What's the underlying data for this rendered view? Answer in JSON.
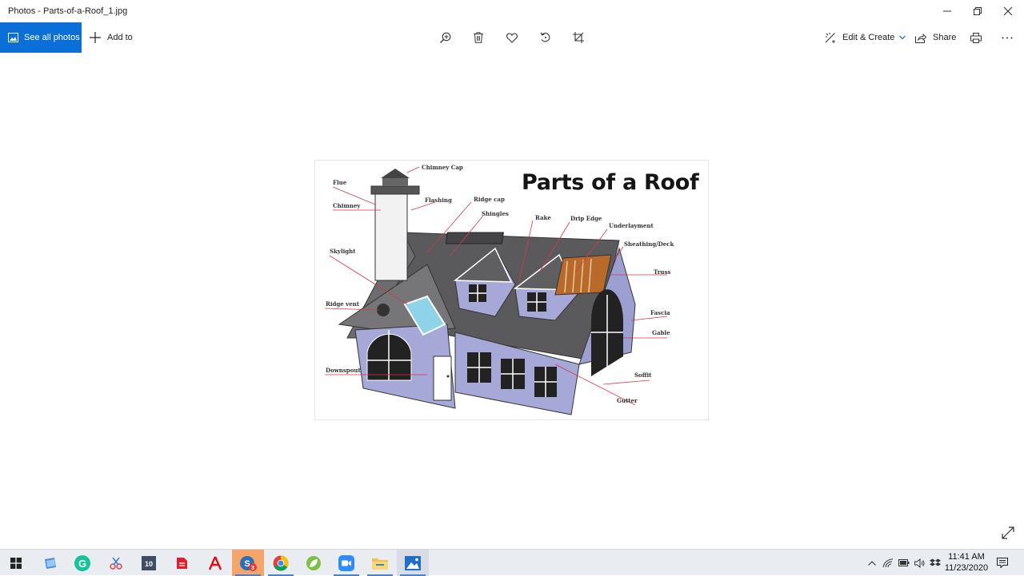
{
  "window": {
    "title": "Photos - Parts-of-a-Roof_1.jpg",
    "minimize_icon": "minimize-icon",
    "restore_icon": "restore-icon",
    "close_icon": "close-icon"
  },
  "toolbar": {
    "see_all_label": "See all photos",
    "add_to_label": "Add to",
    "zoom_icon": "zoom-in-icon",
    "delete_icon": "trash-icon",
    "favorite_icon": "heart-icon",
    "rotate_icon": "rotate-icon",
    "crop_icon": "crop-icon",
    "edit_create_label": "Edit & Create",
    "share_label": "Share",
    "print_icon": "printer-icon",
    "more_icon": "more-icon"
  },
  "photo": {
    "title": "Parts of a Roof",
    "labels": {
      "chimney_cap": "Chimney Cap",
      "flue": "Flue",
      "flashing": "Flashing",
      "ridge_cap": "Ridge cap",
      "chimney": "Chimney",
      "shingles": "Shingles",
      "rake": "Rake",
      "drip_edge": "Drip Edge",
      "underlayment": "Underlayment",
      "sheathing": "Sheathing/Deck",
      "skylight": "Skylight",
      "truss": "Truss",
      "ridge_vent": "Ridge vent",
      "fascia": "Fascia",
      "gable": "Gable",
      "downspout": "Downspout",
      "soffit": "Soffit",
      "gutter": "Gutter"
    },
    "colors": {
      "roof": "#5a5a5c",
      "wall": "#a6a8d8",
      "skylight": "#8fd3e8",
      "leader": "#d4394a",
      "deck": "#b86a2a"
    }
  },
  "taskbar": {
    "apps": [
      "windows-start",
      "file-explorer-blue",
      "grammarly",
      "snipping-tool",
      "windows-10-app",
      "pdf-reader",
      "acrobat",
      "screencast-app",
      "chrome",
      "nitro-app",
      "zoom",
      "file-explorer",
      "photos"
    ],
    "clock_time": "11:41 AM",
    "clock_date": "11/23/2020"
  }
}
